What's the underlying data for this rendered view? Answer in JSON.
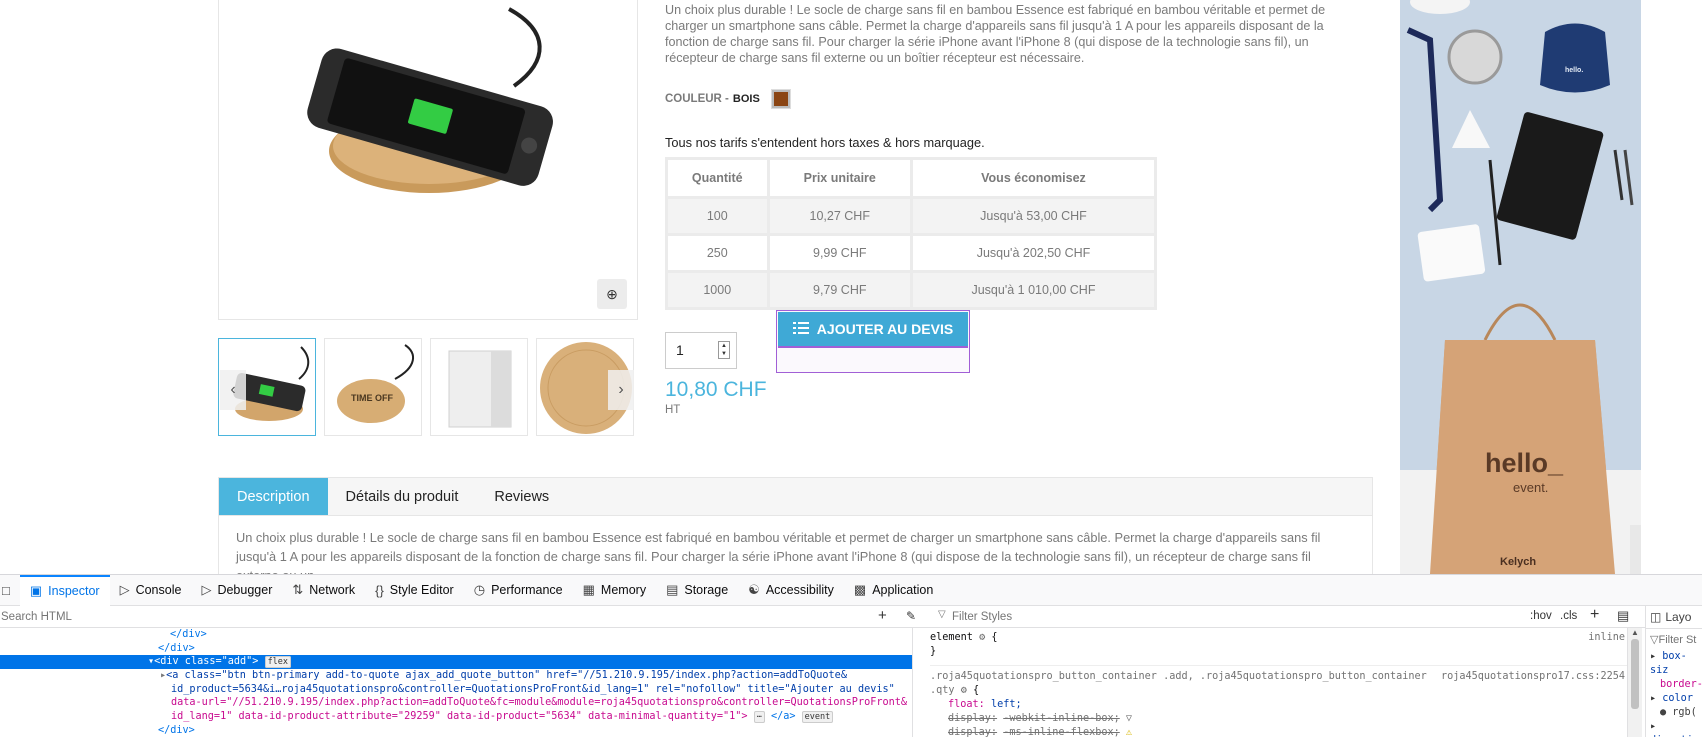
{
  "product": {
    "short_description": "Un choix plus durable ! Le socle de charge sans fil en bambou Essence est fabriqué en bambou véritable et permet de charger un smartphone sans câble. Permet la charge d'appareils sans fil jusqu'à 1 A pour les appareils disposant de la fonction de charge sans fil. Pour charger la série iPhone avant l'iPhone 8 (qui dispose de la technologie sans fil), un récepteur de charge sans fil externe ou un boîtier récepteur est nécessaire.",
    "color_label": "COULEUR -",
    "color_value": "BOIS",
    "swatch_color": "#8b4513",
    "tarif_note": "Tous nos tarifs s'entendent hors taxes & hors marquage.",
    "table": {
      "headers": [
        "Quantité",
        "Prix unitaire",
        "Vous économisez"
      ],
      "rows": [
        [
          "100",
          "10,27 CHF",
          "Jusqu'à 53,00 CHF"
        ],
        [
          "250",
          "9,99 CHF",
          "Jusqu'à 202,50 CHF"
        ],
        [
          "1000",
          "9,79 CHF",
          "Jusqu'à 1 010,00 CHF"
        ]
      ]
    },
    "quantity": "1",
    "add_button_label": "AJOUTER AU DEVIS",
    "price": "10,80 CHF",
    "price_suffix": "HT"
  },
  "tabs": {
    "items": [
      "Description",
      "Détails du produit",
      "Reviews"
    ],
    "content": "Un choix plus durable ! Le socle de charge sans fil en bambou Essence est fabriqué en bambou véritable et permet de charger un smartphone sans câble. Permet la charge d'appareils sans fil jusqu'à 1 A pour les appareils disposant de la fonction de charge sans fil. Pour charger la série iPhone avant l'iPhone 8 (qui dispose de la technologie sans fil), un récepteur de charge sans fil externe ou un"
  },
  "banner": {
    "bag_text": "hello_",
    "bag_subtext": "event.",
    "brand": "Kelych",
    "beanie_text": "hello."
  },
  "thumbs": {
    "thumb2_text": "TIME OFF"
  },
  "devtools": {
    "tabs": [
      "Inspector",
      "Console",
      "Debugger",
      "Network",
      "Style Editor",
      "Performance",
      "Memory",
      "Storage",
      "Accessibility",
      "Application"
    ],
    "search_html_placeholder": "Search HTML",
    "filter_styles_placeholder": "Filter Styles",
    "hov_label": ":hov",
    "cls_label": ".cls",
    "layout_label": "Layo",
    "filter_short": "Filter St",
    "html_lines": {
      "l1": "</div>",
      "l2": "</div>",
      "l3_tag": "<div class=\"add\">",
      "l3_badge": "flex",
      "l4": "<a class=\"btn btn-primary add-to-quote ajax_add_quote_button\" href=\"//51.210.9.195/index.php?action=addToQuote&",
      "l5": "id_product=5634&i…roja45quotationspro&controller=QuotationsProFront&id_lang=1\" rel=\"nofollow\" title=\"Ajouter au devis\"",
      "l6": "data-url=\"//51.210.9.195/index.php?action=addToQuote&fc=module&module=roja45quotationspro&controller=QuotationsProFront&",
      "l7": "id_lang=1\" data-id-product-attribute=\"29259\" data-id-product=\"5634\" data-minimal-quantity=\"1\">",
      "l7_badge": "event",
      "l7_end": "</a>",
      "l8": "</div>"
    },
    "rules": {
      "element_sel": "element",
      "inline": "inline",
      "selector": ".roja45quotationspro_button_container .add, .roja45quotationspro_button_container",
      "selector2": ".qty",
      "source": "roja45quotationspro17.css:2254",
      "prop1": "float:",
      "val1": "left;",
      "prop2": "display:",
      "val2": "-webkit-inline-box;",
      "prop3": "display:",
      "val3": "-ms-inline-flexbox;"
    },
    "layout_props": [
      "box-siz",
      "border-",
      "color",
      "rgb(",
      "directi"
    ]
  }
}
